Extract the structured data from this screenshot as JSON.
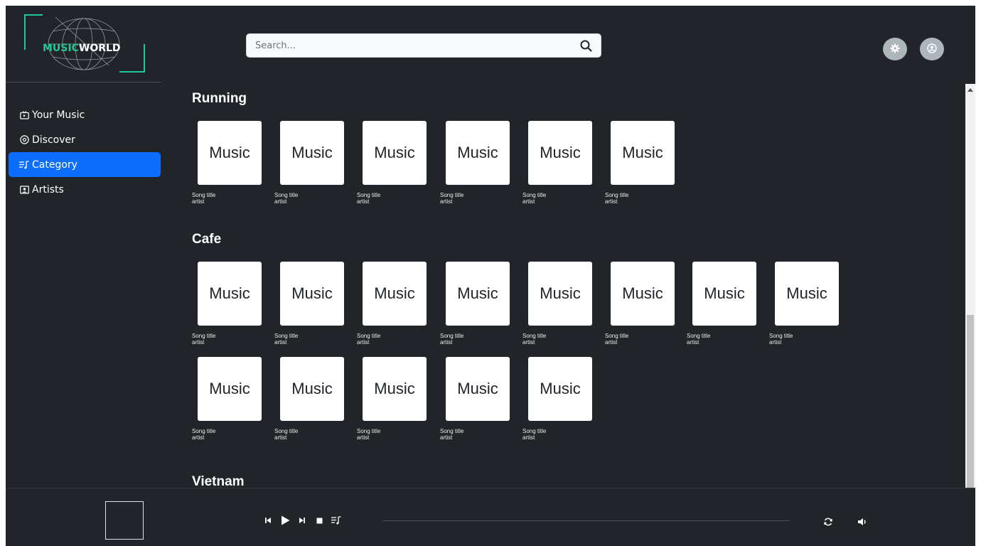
{
  "brand": {
    "part1": "MUSIC",
    "part2": "WORLD"
  },
  "search": {
    "placeholder": "Search..."
  },
  "nav": [
    {
      "label": "Your Music",
      "icon": "tv-icon"
    },
    {
      "label": "Discover",
      "icon": "disc-icon"
    },
    {
      "label": "Category",
      "icon": "music-list-icon",
      "active": true
    },
    {
      "label": "Artists",
      "icon": "person-card-icon"
    }
  ],
  "sections": [
    {
      "title": "Running",
      "cards": [
        {
          "cover": "Music",
          "title": "Song title",
          "artist": "artist"
        },
        {
          "cover": "Music",
          "title": "Song title",
          "artist": "artist"
        },
        {
          "cover": "Music",
          "title": "Song title",
          "artist": "artist"
        },
        {
          "cover": "Music",
          "title": "Song title",
          "artist": "artist"
        },
        {
          "cover": "Music",
          "title": "Song title",
          "artist": "artist"
        },
        {
          "cover": "Music",
          "title": "Song title",
          "artist": "artist"
        }
      ]
    },
    {
      "title": "Cafe",
      "cards": [
        {
          "cover": "Music",
          "title": "Song title",
          "artist": "artist"
        },
        {
          "cover": "Music",
          "title": "Song title",
          "artist": "artist"
        },
        {
          "cover": "Music",
          "title": "Song title",
          "artist": "artist"
        },
        {
          "cover": "Music",
          "title": "Song title",
          "artist": "artist"
        },
        {
          "cover": "Music",
          "title": "Song title",
          "artist": "artist"
        },
        {
          "cover": "Music",
          "title": "Song title",
          "artist": "artist"
        },
        {
          "cover": "Music",
          "title": "Song title",
          "artist": "artist"
        },
        {
          "cover": "Music",
          "title": "Song title",
          "artist": "artist"
        },
        {
          "cover": "Music",
          "title": "Song title",
          "artist": "artist"
        },
        {
          "cover": "Music",
          "title": "Song title",
          "artist": "artist"
        },
        {
          "cover": "Music",
          "title": "Song title",
          "artist": "artist"
        },
        {
          "cover": "Music",
          "title": "Song title",
          "artist": "artist"
        },
        {
          "cover": "Music",
          "title": "Song title",
          "artist": "artist"
        }
      ]
    },
    {
      "title": "Vietnam",
      "cards": []
    }
  ],
  "player": {
    "controls": [
      "skip-back-icon",
      "play-icon",
      "skip-forward-icon",
      "stop-icon",
      "playlist-icon"
    ],
    "right_controls": [
      "repeat-icon",
      "volume-icon"
    ]
  },
  "colors": {
    "background": "#212529",
    "accent": "#20c997",
    "active": "#0d6efd"
  }
}
